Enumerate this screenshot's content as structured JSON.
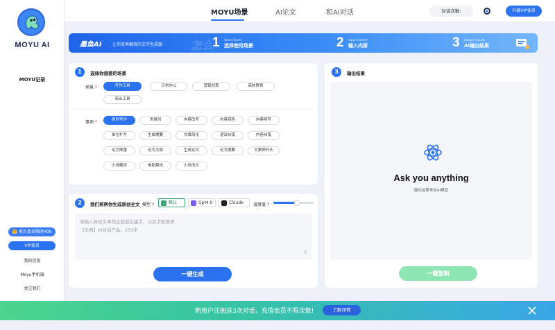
{
  "brand": {
    "name": "MOYU AI"
  },
  "sidebar": {
    "record": "MOYU记录",
    "promo_button": "永久会员限时¥99",
    "vip_button": "VIP会员",
    "links": [
      "我的信息",
      "Moyu手机端",
      "关注我们"
    ]
  },
  "nav": {
    "tabs": [
      {
        "label": "MOYU场景",
        "active": true
      },
      {
        "label": "AI论文",
        "active": false
      },
      {
        "label": "和AI对话",
        "active": false
      }
    ],
    "count_label": "对话次数:",
    "vip_label": "升级VIP会员"
  },
  "banner": {
    "title": "墨鱼AI",
    "subtitle": "让你效率翻倍的文字生成器",
    "watermark": "怎么",
    "steps": [
      {
        "num": "1",
        "en": "Select Scene",
        "cn": "选择使用场景"
      },
      {
        "num": "2",
        "en": "Input Content",
        "cn": "输入内容"
      },
      {
        "num": "3",
        "en": "Output Results",
        "cn": "AI输出结果"
      }
    ]
  },
  "scene_card": {
    "number": "1",
    "title": "选择你想要的场景",
    "scene_label": "场景:",
    "scenes": [
      {
        "label": "写作工具",
        "selected": true
      },
      {
        "label": "日常办公",
        "selected": false
      },
      {
        "label": "营销创意",
        "selected": false
      },
      {
        "label": "高校教育",
        "selected": false
      },
      {
        "label": "商业工具",
        "selected": false
      }
    ],
    "item_label": "事项:",
    "items": [
      {
        "label": "原创写作",
        "selected": true
      },
      {
        "label": "伪原创",
        "selected": false
      },
      {
        "label": "内容改写",
        "selected": false
      },
      {
        "label": "内容润色",
        "selected": false
      },
      {
        "label": "内容续写",
        "selected": false
      },
      {
        "label": "单位扩写",
        "selected": false
      },
      {
        "label": "生成摘要",
        "selected": false
      },
      {
        "label": "文章简化",
        "selected": false
      },
      {
        "label": "语法纠错",
        "selected": false
      },
      {
        "label": "内容纠错",
        "selected": false
      },
      {
        "label": "论文降重",
        "selected": false
      },
      {
        "label": "论文大纲",
        "selected": false
      },
      {
        "label": "生成论文",
        "selected": false
      },
      {
        "label": "论文摘要",
        "selected": false
      },
      {
        "label": "文案神开头",
        "selected": false
      },
      {
        "label": "小说解说",
        "selected": false
      },
      {
        "label": "电影解说",
        "selected": false
      },
      {
        "label": "小说改文",
        "selected": false
      }
    ]
  },
  "input_card": {
    "number": "2",
    "title": "我们将帮你生成原创全文",
    "model_label": "模型 ?",
    "models": [
      {
        "label": "默认",
        "selected": true,
        "color": "#3aa876"
      },
      {
        "label": "Gpt4.0",
        "selected": false,
        "color": "#7b5cf0"
      },
      {
        "label": "Claude",
        "selected": false,
        "color": "#222222"
      }
    ],
    "temperature_label": "温度值 ?",
    "temperature": 0.6,
    "placeholder_line1": "请输入原创文章的主题或关键字、以及字数要求",
    "placeholder_line2": "【示例】AI对话产品，250字",
    "char_count": "0",
    "generate_button": "一键生成"
  },
  "output_card": {
    "number": "3",
    "title": "输出结果",
    "headline": "Ask you anything",
    "subtext": "输出结果来自AI模型",
    "copy_button": "一键复制"
  },
  "promo": {
    "text": "新用户注册送3次对话，充值会员不限次数!",
    "button": "了解详情"
  },
  "colors": {
    "primary": "#2a72f0",
    "promo_green": "#4cd58d",
    "copy_green": "#8ee6b3"
  }
}
